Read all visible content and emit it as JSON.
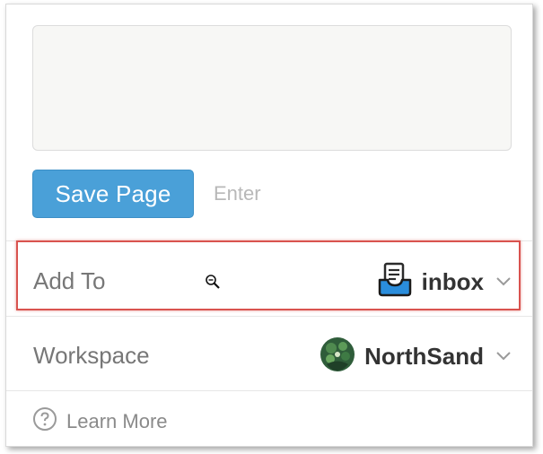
{
  "form": {
    "save_label": "Save Page",
    "enter_hint": "Enter"
  },
  "add_to": {
    "label": "Add To",
    "value": "inbox",
    "icon": "inbox-tray-icon"
  },
  "workspace": {
    "label": "Workspace",
    "value": "NorthSand",
    "icon": "workspace-avatar"
  },
  "learn_more": {
    "label": "Learn More",
    "icon": "help-circle-icon"
  },
  "colors": {
    "button": "#4aa0d8",
    "highlight": "#d9534f"
  }
}
